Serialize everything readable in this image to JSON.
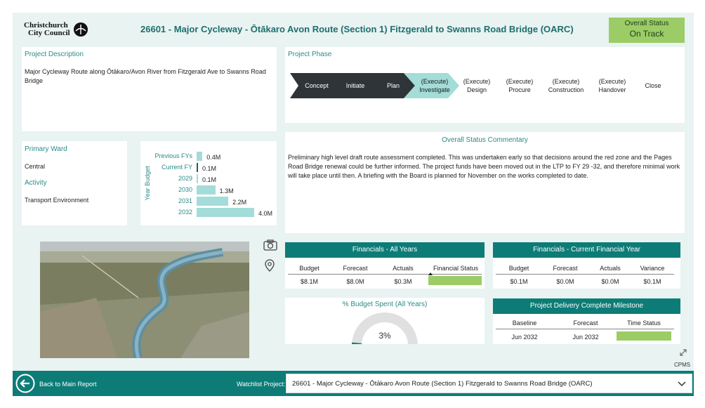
{
  "header": {
    "logo_line1": "Christchurch",
    "logo_line2": "City Council",
    "title": "26601 - Major Cycleway - Ōtākaro Avon Route (Section 1)  Fitzgerald to Swanns Road Bridge (OARC)",
    "status_label": "Overall Status",
    "status_value": "On Track",
    "status_color": "#9ccc65"
  },
  "description": {
    "title": "Project Description",
    "text": "Major Cycleway Route along Ōtākaro/Avon River from Fitzgerald Ave to Swanns Road Bridge"
  },
  "phase": {
    "title": "Project Phase",
    "steps": [
      {
        "line1": "Concept",
        "line2": ""
      },
      {
        "line1": "Initiate",
        "line2": ""
      },
      {
        "line1": "Plan",
        "line2": ""
      },
      {
        "line1": "(Execute)",
        "line2": "Investigate"
      },
      {
        "line1": "(Execute)",
        "line2": "Design"
      },
      {
        "line1": "(Execute)",
        "line2": "Procure"
      },
      {
        "line1": "(Execute)",
        "line2": "Construction"
      },
      {
        "line1": "(Execute)",
        "line2": "Handover"
      },
      {
        "line1": "Close",
        "line2": ""
      }
    ]
  },
  "ward": {
    "title": "Primary Ward",
    "value": "Central",
    "activity_title": "Activity",
    "activity_value": "Transport Environment"
  },
  "budget_chart": {
    "ylabel": "Year Budget",
    "chart_data": {
      "type": "bar",
      "orientation": "horizontal",
      "categories": [
        "Previous FYs",
        "Current FY",
        "2029",
        "2030",
        "2031",
        "2032"
      ],
      "values": [
        0.4,
        0.1,
        0.1,
        1.3,
        2.2,
        4.0
      ],
      "labels": [
        "0.4M",
        "0.1M",
        "0.1M",
        "1.3M",
        "2.2M",
        "4.0M"
      ],
      "colors": [
        "#a3dcd8",
        "#1f5e5b",
        "#a3dcd8",
        "#a3dcd8",
        "#a3dcd8",
        "#a3dcd8"
      ],
      "xlim": [
        0,
        4.0
      ]
    }
  },
  "commentary": {
    "title": "Overall Status Commentary",
    "text": "Preliminary high level draft route assessment completed. This was undertaken early so that decisions around the red zone and the Pages Road Bridge renewal could be further informed. The project funds have been moved out in the LTP to FY 29 -32, and therefore minimal work will take place until then. A briefing with the Board is planned for November on the works completed to date."
  },
  "fin_all": {
    "title": "Financials - All Years",
    "headers": [
      "Budget",
      "Forecast",
      "Actuals",
      "Financial Status"
    ],
    "values": [
      "$8.1M",
      "$8.0M",
      "$0.3M"
    ],
    "status_color": "#9ccc65"
  },
  "fin_current": {
    "title": "Financials - Current Financial Year",
    "headers": [
      "Budget",
      "Forecast",
      "Actuals",
      "Variance"
    ],
    "values": [
      "$0.1M",
      "$0.0M",
      "$0.0M",
      "$0.1M"
    ]
  },
  "budget_spent": {
    "title": "% Budget Spent (All Years)",
    "value_label": "3%",
    "fraction": 0.03
  },
  "milestone": {
    "title": "Project Delivery Complete Milestone",
    "headers": [
      "Baseline",
      "Forecast",
      "Time Status"
    ],
    "values": [
      "Jun 2032",
      "Jun 2032"
    ],
    "status_color": "#9ccc65"
  },
  "footer": {
    "back_label": "Back to Main Report",
    "watchlist_label": "Watchlist Project:",
    "watchlist_value": "26601 - Major Cycleway - Ōtākaro Avon Route (Section 1) Fitzgerald to Swanns Road Bridge (OARC)",
    "cpms": "CPMS"
  },
  "icons": [
    "camera-icon",
    "location-pin-icon",
    "back-arrow-icon",
    "chevron-down-icon",
    "expand-icon"
  ]
}
